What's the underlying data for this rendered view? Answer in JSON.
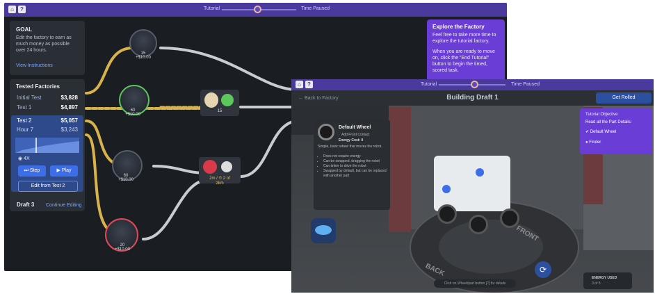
{
  "win1": {
    "topbar": {
      "tutorial_label": "Tutorial",
      "time_label": "Time Paused"
    },
    "goal": {
      "heading": "GOAL",
      "text": "Edit the factory to earn as much money as possible over 24 hours.",
      "link": "View Instructions"
    },
    "tested": {
      "heading": "Tested Factories",
      "rows": [
        {
          "label": "Initial Test",
          "value": "$3,828"
        },
        {
          "label": "Test 1",
          "value": "$4,897"
        },
        {
          "label": "Test 2",
          "value": "$5,057"
        },
        {
          "label": "Hour 7",
          "value": "$3,243"
        }
      ],
      "speed_label": "4X",
      "step_label": "Step",
      "play_label": "Play",
      "edit_label": "Edit from Test 2",
      "draft_label": "Draft 3",
      "continue_label": "Continue Editing"
    },
    "explore": {
      "title": "Explore the Factory",
      "text1": "Feel free to take more time to explore the tutorial factory.",
      "text2": "When you are ready to move on, click the \"End Tutorial\" button to begin the timed, scored task."
    },
    "nodes": [
      {
        "count": "15",
        "price": "+$10.00"
      },
      {
        "count": "60",
        "price": "+$10.00"
      },
      {
        "count": "60",
        "price": "+$10.00"
      },
      {
        "count": "20",
        "price": "+$10.00"
      }
    ],
    "assembly1": {
      "count": "15"
    },
    "assembly2": {
      "label": "2m / ⏱ 2 of 2km"
    }
  },
  "win2": {
    "topbar": {
      "tutorial_label": "Tutorial",
      "time_label": "Time Paused"
    },
    "back_label": "← Back to Factory",
    "title": "Building Draft 1",
    "done_label": "Get Rolled",
    "part": {
      "name": "Default Wheel",
      "sub1": "Add Front Contact",
      "sub2": "Energy Cost: 0",
      "desc": "Simple, basic wheel that moves the robot.",
      "bullets": [
        "Does not require energy",
        "Can be swapped, dragging the robot",
        "Can tinker to drive the robot",
        "Swapped by default, but can be replaced with another part"
      ]
    },
    "objective": {
      "heading": "Tutorial Objective",
      "text": "Read all the Part Details:",
      "items": [
        "Default Wheel",
        "Finder"
      ]
    },
    "hint": "Click on Wheel/part button [?] for details",
    "energy": {
      "label": "ENERGY USED",
      "value": "0 of 5"
    },
    "floor_text": {
      "front": "FRONT",
      "back": "BACK"
    }
  }
}
